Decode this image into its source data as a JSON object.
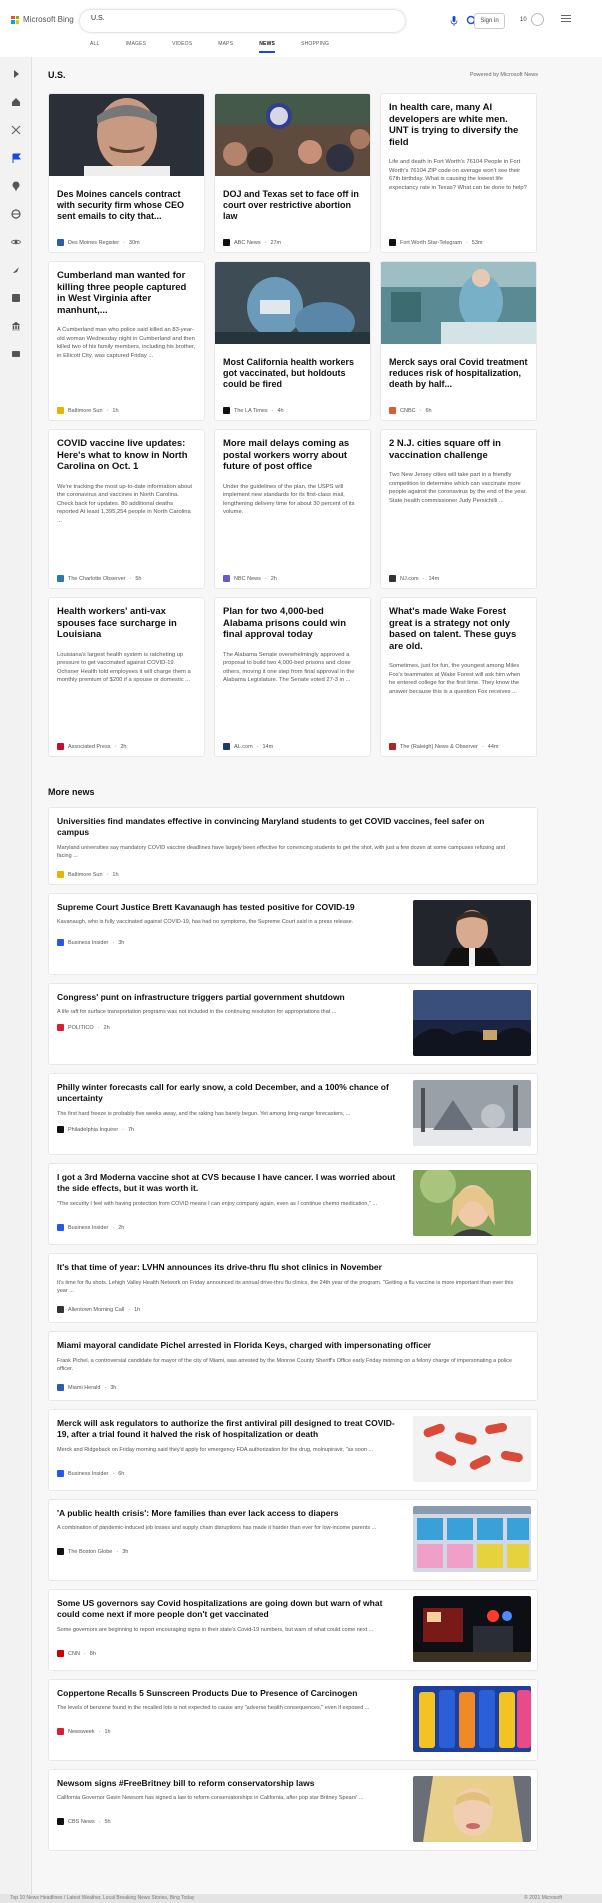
{
  "brand": {
    "name": "Microsoft Bing",
    "logo_colors": [
      "#f25022",
      "#7fba00",
      "#00a4ef",
      "#ffb900"
    ]
  },
  "search": {
    "value": "U.S."
  },
  "header": {
    "signin_label": "Sign in",
    "rewards_count": "10"
  },
  "tabs": [
    {
      "label": "ALL"
    },
    {
      "label": "IMAGES"
    },
    {
      "label": "VIDEOS"
    },
    {
      "label": "MAPS"
    },
    {
      "label": "NEWS"
    },
    {
      "label": "SHOPPING"
    }
  ],
  "active_tab": "NEWS",
  "accent_color": "#174ae4",
  "sidebar": {
    "icons": [
      "expand-icon",
      "home-icon",
      "discover-icon",
      "flag-icon",
      "location-icon",
      "globe-icon",
      "science-icon",
      "rocket-icon",
      "entertainment-icon",
      "bank-icon",
      "money-icon"
    ]
  },
  "section": {
    "title": "U.S.",
    "powered_by": "Powered by Microsoft News"
  },
  "cards": [
    {
      "title": "Des Moines cancels contract with security firm whose CEO sent emails to city that...",
      "source": "Des Moines Register",
      "time": "30m",
      "image": "portrait-man"
    },
    {
      "title": "DOJ and Texas set to face off in court over restrictive abortion law",
      "source": "ABC News",
      "time": "27m",
      "image": "protest-crowd"
    },
    {
      "title": "In health care, many AI developers are white men. UNT is trying to diversify the field",
      "snippet": "Life and death in Fort Worth's 76104 People in Fort Worth's 76104 ZIP code on average won't see their 67th birthday. What is causing the lowest life expectancy rate in Texas? What can be done to help?",
      "source": "Fort Worth Star-Telegram",
      "time": "53m"
    },
    {
      "title": "Cumberland man wanted for killing three people captured in West Virginia after manhunt,...",
      "snippet": "A Cumberland man who police said killed an 83-year-old woman Wednesday night in Cumberland and then killed two of his family members, including his brother, in Ellicott City, was captured Friday ...",
      "source": "Baltimore Sun",
      "time": "1h"
    },
    {
      "title": "Most California health workers got vaccinated, but holdouts could be fired",
      "source": "The LA Times",
      "time": "4h",
      "image": "health-worker"
    },
    {
      "title": "Merck says oral Covid treatment reduces risk of hospitalization, death by half...",
      "source": "CNBC",
      "time": "6h",
      "image": "hospital-room"
    },
    {
      "title": "COVID vaccine live updates: Here's what to know in North Carolina on Oct. 1",
      "snippet": "We're tracking the most up-to-date information about the coronavirus and vaccines in North Carolina. Check back for updates. 80 additional deaths reported At least 1,395,254 people in North Carolina ...",
      "source": "The Charlotte Observer",
      "time": "5h"
    },
    {
      "title": "More mail delays coming as postal workers worry about future of post office",
      "snippet": "Under the guidelines of the plan, the USPS will implement new standards for its first-class mail, lengthening delivery time for about 30 percent of its volume.",
      "source": "NBC News",
      "time": "2h"
    },
    {
      "title": "2 N.J. cities square off in vaccination challenge",
      "snippet": "Two New Jersey cities will take part in a friendly competition to determine which can vaccinate more people against the coronavirus by the end of the year. State health commissioner Judy Persichilli ...",
      "source": "NJ.com",
      "time": "14m"
    },
    {
      "title": "Health workers' anti-vax spouses face surcharge in Louisiana",
      "snippet": "Louisiana's largest health system is ratcheting up pressure to get vaccinated against COVID-19. Ochsner Health told employees it will charge them a monthly premium of $200 if a spouse or domestic ...",
      "source": "Associated Press",
      "time": "2h"
    },
    {
      "title": "Plan for two 4,000-bed Alabama prisons could win final approval today",
      "snippet": "The Alabama Senate overwhelmingly approved a proposal to build two 4,000-bed prisons and close others, moving it one step from final approval in the Alabama Legislature. The Senate voted 27-3 in ...",
      "source": "AL.com",
      "time": "14m"
    },
    {
      "title": "What's made Wake Forest great is a strategy not only based on talent. These guys are old.",
      "snippet": "Sometimes, just for fun, the youngest among Miles Fox's teammates at Wake Forest will ask him when he entered college for the first time. They know the answer because this is a question Fox receives ...",
      "source": "The (Raleigh) News & Observer",
      "time": "44m"
    }
  ],
  "more_news": {
    "title": "More news",
    "items": [
      {
        "title": "Universities find mandates effective in convincing Maryland students to get COVID vaccines, feel safer on campus",
        "snippet": "Maryland universities say mandatory COVID vaccine deadlines have largely been effective for convincing students to get the shot, with just a few dozen at some campuses refusing and facing ...",
        "source": "Baltimore Sun",
        "time": "1h"
      },
      {
        "title": "Supreme Court Justice Brett Kavanaugh has tested positive for COVID-19",
        "snippet": "Kavanaugh, who is fully vaccinated against COVID-19, has had no symptoms, the Supreme Court said in a press release.",
        "source": "Business Insider",
        "time": "3h",
        "image": "portrait-judge"
      },
      {
        "title": "Congress' punt on infrastructure triggers partial government shutdown",
        "snippet": "A life raft for surface transportation programs was not included in the continuing resolution for appropriations that ...",
        "source": "POLITICO",
        "time": "2h",
        "image": "capitol-night"
      },
      {
        "title": "Philly winter forecasts call for early snow, a cold December, and a 100% chance of uncertainty",
        "snippet": "The first hard freeze is probably five weeks away, and the raking has barely begun. Yet among long-range forecasters, ...",
        "source": "Philadelphia Inquirer",
        "time": "7h",
        "image": "snowy-park"
      },
      {
        "title": "I got a 3rd Moderna vaccine shot at CVS because I have cancer. I was worried about the side effects, but it was worth it.",
        "snippet": "\"The security I feel with having protection from COVID means I can enjoy company again, even as I continue chemo medication,\" ...",
        "source": "Business Insider",
        "time": "2h",
        "image": "portrait-woman"
      },
      {
        "title": "It's that time of year: LVHN announces its drive-thru flu shot clinics in November",
        "snippet": "It's time for flu shots. Lehigh Valley Health Network on Friday announced its annual drive-thru flu clinics, the 24th year of the program. \"Getting a flu vaccine is more important than ever this year ...",
        "source": "Allentown Morning Call",
        "time": "1h"
      },
      {
        "title": "Miami mayoral candidate Pichel arrested in Florida Keys, charged with impersonating officer",
        "snippet": "Frank Pichel, a controversial candidate for mayor of the city of Miami, was arrested by the Monroe County Sheriff's Office early Friday morning on a felony charge of impersonating a police officer.",
        "source": "Miami Herald",
        "time": "3h"
      },
      {
        "title": "Merck will ask regulators to authorize the first antiviral pill designed to treat COVID-19, after a trial found it halved the risk of hospitalization or death",
        "snippet": "Merck and Ridgeback on Friday morning said they'd apply for emergency FDA authorization for the drug, molnupiravir, \"as soon ...",
        "source": "Business Insider",
        "time": "6h",
        "image": "red-pills"
      },
      {
        "title": "'A public health crisis': More families than ever lack access to diapers",
        "snippet": "A combination of pandemic-induced job losses and supply chain disruptions has made it harder than ever for low-income parents ...",
        "source": "The Boston Globe",
        "time": "3h",
        "image": "diaper-shelves"
      },
      {
        "title": "Some US governors say Covid hospitalizations are going down but warn of what could come next if more people don't get vaccinated",
        "snippet": "Some governors are beginning to report encouraging signs in their state's Covid-19 numbers, but warn of what could come next ...",
        "source": "CNN",
        "time": "8h",
        "image": "ambulance-night"
      },
      {
        "title": "Coppertone Recalls 5 Sunscreen Products Due to Presence of Carcinogen",
        "snippet": "The levels of benzene found in the recalled lots is not expected to cause any \"adverse health consequences,\" even if exposed ...",
        "source": "Newsweek",
        "time": "1h",
        "image": "sunscreen-bottles"
      },
      {
        "title": "Newsom signs #FreeBritney bill to reform conservatorship laws",
        "snippet": "California Governor Gavin Newsom has signed a law to reform conservatorships in California, after pop star Britney Spears' ...",
        "source": "CBS News",
        "time": "5h",
        "image": "portrait-blonde"
      }
    ]
  },
  "footer": {
    "left": "Top 10 News Headlines / Latest Weather, Local Breaking News Stories, Bing Today",
    "right": "© 2021 Microsoft"
  }
}
